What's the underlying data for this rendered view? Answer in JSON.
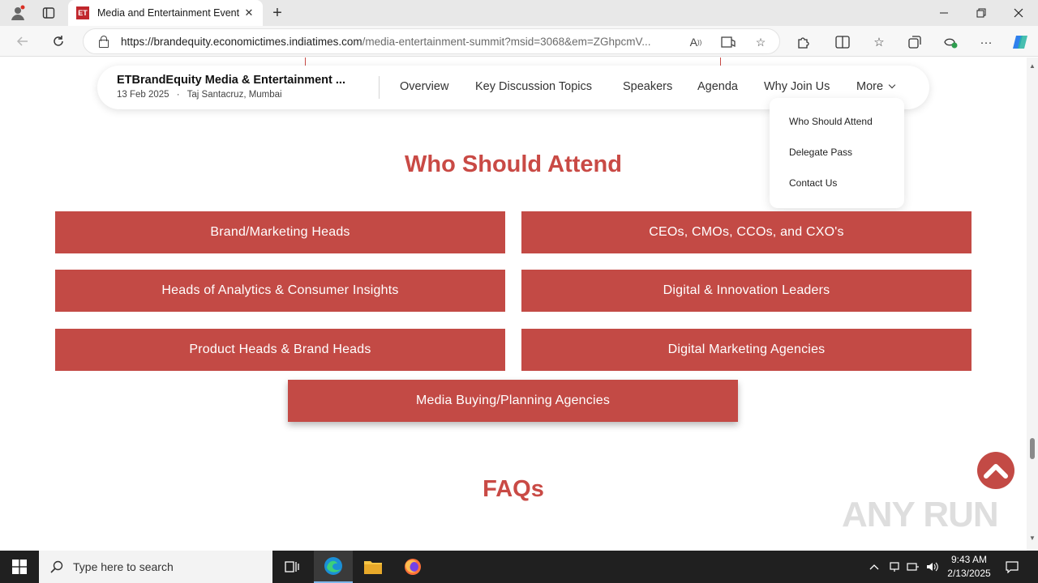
{
  "browser": {
    "tab_title": "Media and Entertainment Event |",
    "tab_favicon": "ET",
    "url_host": "https://brandequity.economictimes.indiatimes.com",
    "url_rest": "/media-entertainment-summit?msid=3068&em=ZGhpcmV..."
  },
  "nav": {
    "event_title": "ETBrandEquity Media & Entertainment ...",
    "event_date": "13 Feb 2025",
    "event_venue": "Taj Santacruz, Mumbai",
    "links": [
      "Overview",
      "Key Discussion Topics",
      "Speakers",
      "Agenda",
      "Why Join Us",
      "More"
    ]
  },
  "dropdown": {
    "items": [
      "Who Should Attend",
      "Delegate Pass",
      "Contact Us"
    ]
  },
  "section": {
    "title": "Who Should Attend",
    "cards": [
      "Brand/Marketing Heads",
      "CEOs, CMOs, CCOs, and CXO's",
      "Heads of Analytics & Consumer Insights",
      "Digital & Innovation Leaders",
      "Product Heads & Brand Heads",
      "Digital Marketing Agencies",
      "Media Buying/Planning Agencies"
    ]
  },
  "faq": {
    "title": "FAQs"
  },
  "watermark": "ANY RUN",
  "taskbar": {
    "search_placeholder": "Type here to search",
    "time": "9:43 AM",
    "date": "2/13/2025"
  },
  "colors": {
    "accent": "#c34a45",
    "heading": "#c94a45"
  }
}
